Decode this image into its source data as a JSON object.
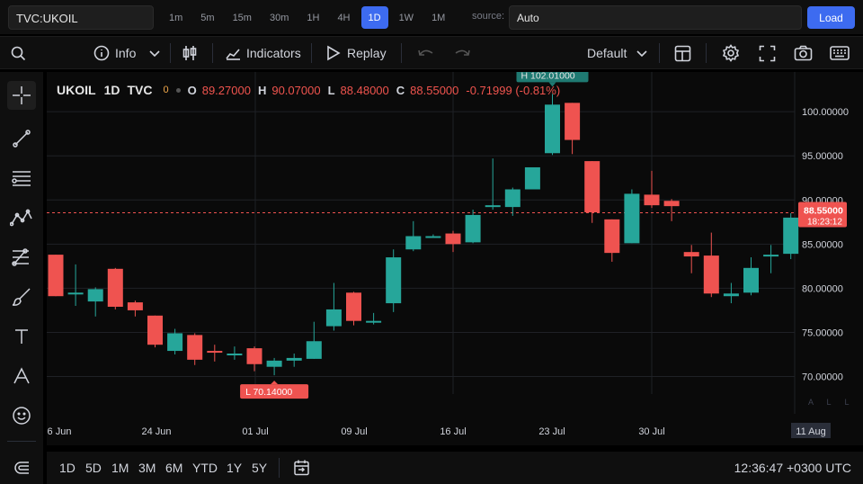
{
  "header": {
    "symbol": "TVC:UKOIL",
    "intervals": [
      "1m",
      "5m",
      "15m",
      "30m",
      "1H",
      "4H",
      "1D",
      "1W",
      "1M"
    ],
    "active_interval": "1D",
    "source_label": "source:",
    "source_value": "Auto",
    "load_label": "Load"
  },
  "toolbar": {
    "info_label": "Info",
    "indicators_label": "Indicators",
    "replay_label": "Replay",
    "layout_label": "Default"
  },
  "legend": {
    "symbol": "UKOIL",
    "interval": "1D",
    "exchange": "TVC",
    "badge": "0",
    "o_label": "O",
    "o_value": "89.27000",
    "h_label": "H",
    "h_value": "90.07000",
    "l_label": "L",
    "l_value": "88.48000",
    "c_label": "C",
    "c_value": "88.55000",
    "change": "-0.71999 (-0.81%)"
  },
  "markers": {
    "high_label": "H",
    "high_value": "102.01000",
    "low_label": "L",
    "low_value": "70.14000"
  },
  "price_scale": {
    "current_price": "88.55000",
    "countdown": "18:23:12",
    "mini_labels": [
      "A",
      "L",
      "L"
    ]
  },
  "chart_data": {
    "type": "candlestick",
    "symbol": "UKOIL",
    "y_ticks": [
      "100.00000",
      "95.00000",
      "90.00000",
      "85.00000",
      "80.00000",
      "75.00000",
      "70.00000"
    ],
    "x_ticks": [
      "6 Jun",
      "24 Jun",
      "01 Jul",
      "09 Jul",
      "16 Jul",
      "23 Jul",
      "30 Jul",
      "11 Aug"
    ],
    "ylim": [
      67.3,
      104.5
    ],
    "current_price": 88.55,
    "up_color": "#26a69a",
    "down_color": "#ef5350",
    "candles": [
      {
        "o": 83.8,
        "h": 83.8,
        "l": 79.1,
        "c": 79.1
      },
      {
        "o": 79.4,
        "h": 82.7,
        "l": 78.0,
        "c": 79.5
      },
      {
        "o": 78.5,
        "h": 80.1,
        "l": 76.8,
        "c": 79.9
      },
      {
        "o": 82.2,
        "h": 82.3,
        "l": 77.6,
        "c": 77.9
      },
      {
        "o": 78.4,
        "h": 78.6,
        "l": 76.8,
        "c": 77.5
      },
      {
        "o": 76.9,
        "h": 76.9,
        "l": 73.3,
        "c": 73.6
      },
      {
        "o": 72.9,
        "h": 75.4,
        "l": 72.5,
        "c": 74.9
      },
      {
        "o": 74.7,
        "h": 74.9,
        "l": 71.3,
        "c": 71.9
      },
      {
        "o": 72.9,
        "h": 73.6,
        "l": 71.7,
        "c": 72.8
      },
      {
        "o": 72.5,
        "h": 73.4,
        "l": 71.9,
        "c": 72.6
      },
      {
        "o": 73.2,
        "h": 73.4,
        "l": 70.6,
        "c": 71.4
      },
      {
        "o": 71.1,
        "h": 72.1,
        "l": 70.14,
        "c": 71.8
      },
      {
        "o": 71.8,
        "h": 72.6,
        "l": 71.1,
        "c": 72.1
      },
      {
        "o": 72.0,
        "h": 76.2,
        "l": 72.0,
        "c": 74.0
      },
      {
        "o": 75.7,
        "h": 80.6,
        "l": 75.2,
        "c": 77.6
      },
      {
        "o": 79.5,
        "h": 79.6,
        "l": 75.8,
        "c": 76.3
      },
      {
        "o": 76.2,
        "h": 77.2,
        "l": 75.9,
        "c": 76.3
      },
      {
        "o": 78.3,
        "h": 84.4,
        "l": 77.3,
        "c": 83.5
      },
      {
        "o": 84.4,
        "h": 87.6,
        "l": 84.2,
        "c": 85.9
      },
      {
        "o": 85.9,
        "h": 86.1,
        "l": 85.8,
        "c": 85.9
      },
      {
        "o": 86.2,
        "h": 86.5,
        "l": 84.1,
        "c": 85.0
      },
      {
        "o": 85.2,
        "h": 88.9,
        "l": 85.1,
        "c": 88.3
      },
      {
        "o": 89.2,
        "h": 94.7,
        "l": 88.9,
        "c": 89.4
      },
      {
        "o": 89.2,
        "h": 91.4,
        "l": 88.2,
        "c": 91.2
      },
      {
        "o": 91.2,
        "h": 93.2,
        "l": 91.2,
        "c": 93.7
      },
      {
        "o": 95.3,
        "h": 102.01,
        "l": 95.1,
        "c": 100.8
      },
      {
        "o": 101.0,
        "h": 101.0,
        "l": 95.2,
        "c": 96.8
      },
      {
        "o": 94.4,
        "h": 94.4,
        "l": 87.4,
        "c": 88.6
      },
      {
        "o": 87.8,
        "h": 87.8,
        "l": 83.0,
        "c": 84.0
      },
      {
        "o": 85.1,
        "h": 91.2,
        "l": 85.1,
        "c": 90.7
      },
      {
        "o": 90.6,
        "h": 93.3,
        "l": 89.1,
        "c": 89.4
      },
      {
        "o": 89.9,
        "h": 90.1,
        "l": 87.6,
        "c": 89.3
      },
      {
        "o": 84.1,
        "h": 84.9,
        "l": 81.7,
        "c": 83.6
      },
      {
        "o": 83.7,
        "h": 86.3,
        "l": 79.0,
        "c": 79.4
      },
      {
        "o": 79.1,
        "h": 80.6,
        "l": 78.3,
        "c": 79.4
      },
      {
        "o": 79.5,
        "h": 83.5,
        "l": 79.2,
        "c": 82.3
      },
      {
        "o": 83.6,
        "h": 84.9,
        "l": 81.7,
        "c": 83.8
      },
      {
        "o": 83.9,
        "h": 88.5,
        "l": 83.3,
        "c": 88.0
      }
    ]
  },
  "bottom": {
    "ranges": [
      "1D",
      "5D",
      "1M",
      "3M",
      "6M",
      "YTD",
      "1Y",
      "5Y"
    ],
    "clock": "12:36:47 +0300 UTC"
  }
}
